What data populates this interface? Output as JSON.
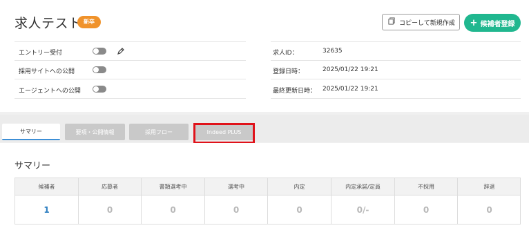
{
  "header": {
    "title": "求人テスト",
    "badge": "新卒",
    "copy_button": "コピーして新規作成",
    "register_button": "候補者登録",
    "accent_color": "#20b78f",
    "badge_color": "#f0922a"
  },
  "settings": [
    {
      "label": "エントリー受付",
      "enabled": false
    },
    {
      "label": "採用サイトへの公開",
      "enabled": false
    },
    {
      "label": "エージェントへの公開",
      "enabled": false
    }
  ],
  "info": [
    {
      "label": "求人ID：",
      "value": "32635"
    },
    {
      "label": "登録日時：",
      "value": "2025/01/22 19:21"
    },
    {
      "label": "最終更新日時：",
      "value": "2025/01/22 19:21"
    }
  ],
  "tabs": [
    {
      "label": "サマリー",
      "active": true
    },
    {
      "label": "要項・公開情報",
      "active": false
    },
    {
      "label": "採用フロー",
      "active": false
    },
    {
      "label": "Indeed PLUS",
      "active": false
    }
  ],
  "summary": {
    "title": "サマリー",
    "columns": [
      {
        "header": "候補者",
        "value": "1"
      },
      {
        "header": "応募者",
        "value": "0"
      },
      {
        "header": "書類選考中",
        "value": "0"
      },
      {
        "header": "選考中",
        "value": "0"
      },
      {
        "header": "内定",
        "value": "0"
      },
      {
        "header": "内定承諾/定員",
        "value": "0/-"
      },
      {
        "header": "不採用",
        "value": "0"
      },
      {
        "header": "辞退",
        "value": "0"
      }
    ]
  }
}
